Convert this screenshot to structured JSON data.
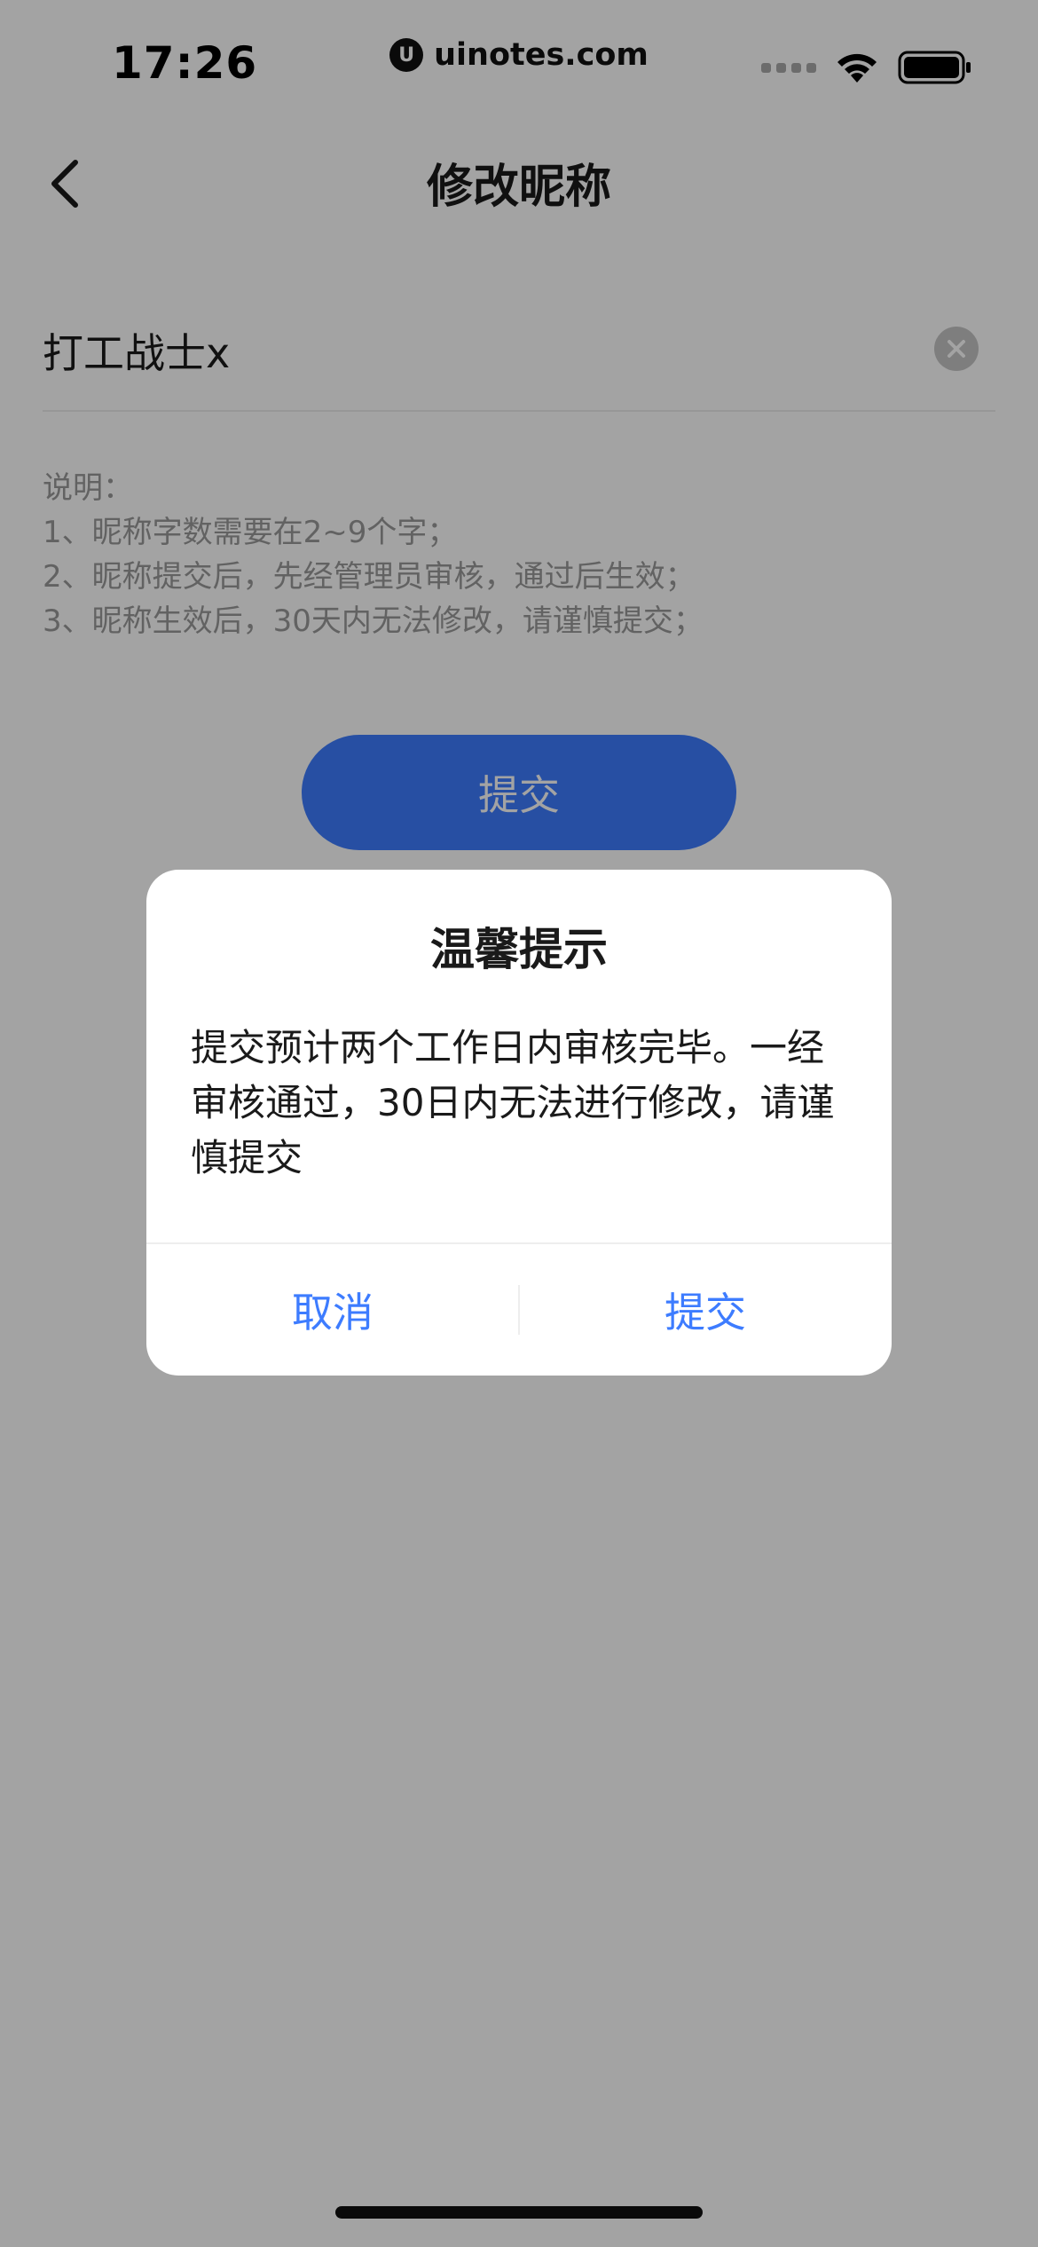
{
  "status_bar": {
    "time": "17:26",
    "url": "uinotes.com",
    "logo": "U"
  },
  "nav": {
    "title": "修改昵称"
  },
  "input": {
    "value": "打工战士x"
  },
  "notes": [
    "说明：",
    "1、昵称字数需要在2~9个字；",
    "2、昵称提交后，先经管理员审核，通过后生效；",
    "3、昵称生效后，30天内无法修改，请谨慎提交；"
  ],
  "submit_label": "提交",
  "dialog": {
    "title": "温馨提示",
    "message": "提交预计两个工作日内审核完毕。一经审核通过，30日内无法进行修改，请谨慎提交",
    "cancel_label": "取消",
    "confirm_label": "提交"
  },
  "colors": {
    "accent": "#3d7cff",
    "overlay": "rgba(0,0,0,0.36)"
  },
  "icons": {
    "back": "chevron-left-icon",
    "clear": "clear-circle-icon",
    "wifi": "wifi-icon",
    "battery": "battery-icon"
  }
}
